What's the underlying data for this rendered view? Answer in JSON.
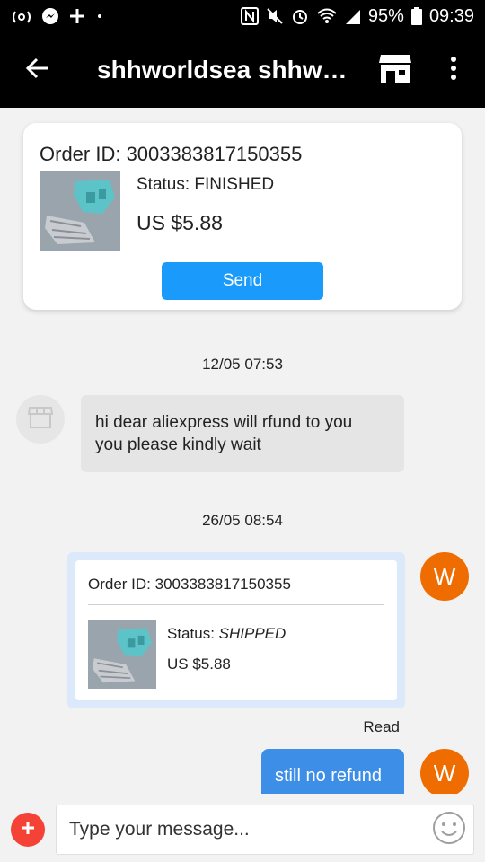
{
  "status_bar": {
    "battery_percent": "95%",
    "time": "09:39",
    "icons": [
      "antenna-icon",
      "messenger-icon",
      "plus-icon",
      "dot-icon",
      "nfc-icon",
      "mute-icon",
      "alarm-icon",
      "wifi-icon",
      "signal-icon",
      "battery-icon"
    ]
  },
  "header": {
    "title": "shhworldsea shhw…",
    "back_icon": "arrow-left-icon",
    "store_icon": "store-icon",
    "more_icon": "more-vertical-icon"
  },
  "order_card": {
    "order_id": "Order ID: 3003383817150355",
    "status": "Status: FINISHED",
    "price": "US $5.88",
    "send_label": "Send"
  },
  "messages": [
    {
      "type": "timestamp",
      "text": "12/05 07:53"
    },
    {
      "type": "incoming",
      "text_lines": [
        "hi dear aliexpress will rfund to you",
        "you please kindly wait"
      ]
    },
    {
      "type": "timestamp",
      "text": "26/05 08:54"
    },
    {
      "type": "outgoing_order",
      "order_id": "Order ID: 3003383817150355",
      "status_label": "Status:",
      "status_value": "SHIPPED",
      "price": "US $5.88"
    },
    {
      "type": "read_receipt",
      "text": "Read"
    },
    {
      "type": "outgoing",
      "text": "still no refund"
    }
  ],
  "avatar_me_letter": "W",
  "composer": {
    "placeholder": "Type your message...",
    "add_icon": "plus-circle-icon",
    "emoji_icon": "smiley-icon"
  },
  "colors": {
    "accent_blue": "#1a9bfc",
    "bubble_out": "#3d8ee6",
    "avatar_orange": "#ef6c00",
    "add_button_red": "#f44336"
  }
}
